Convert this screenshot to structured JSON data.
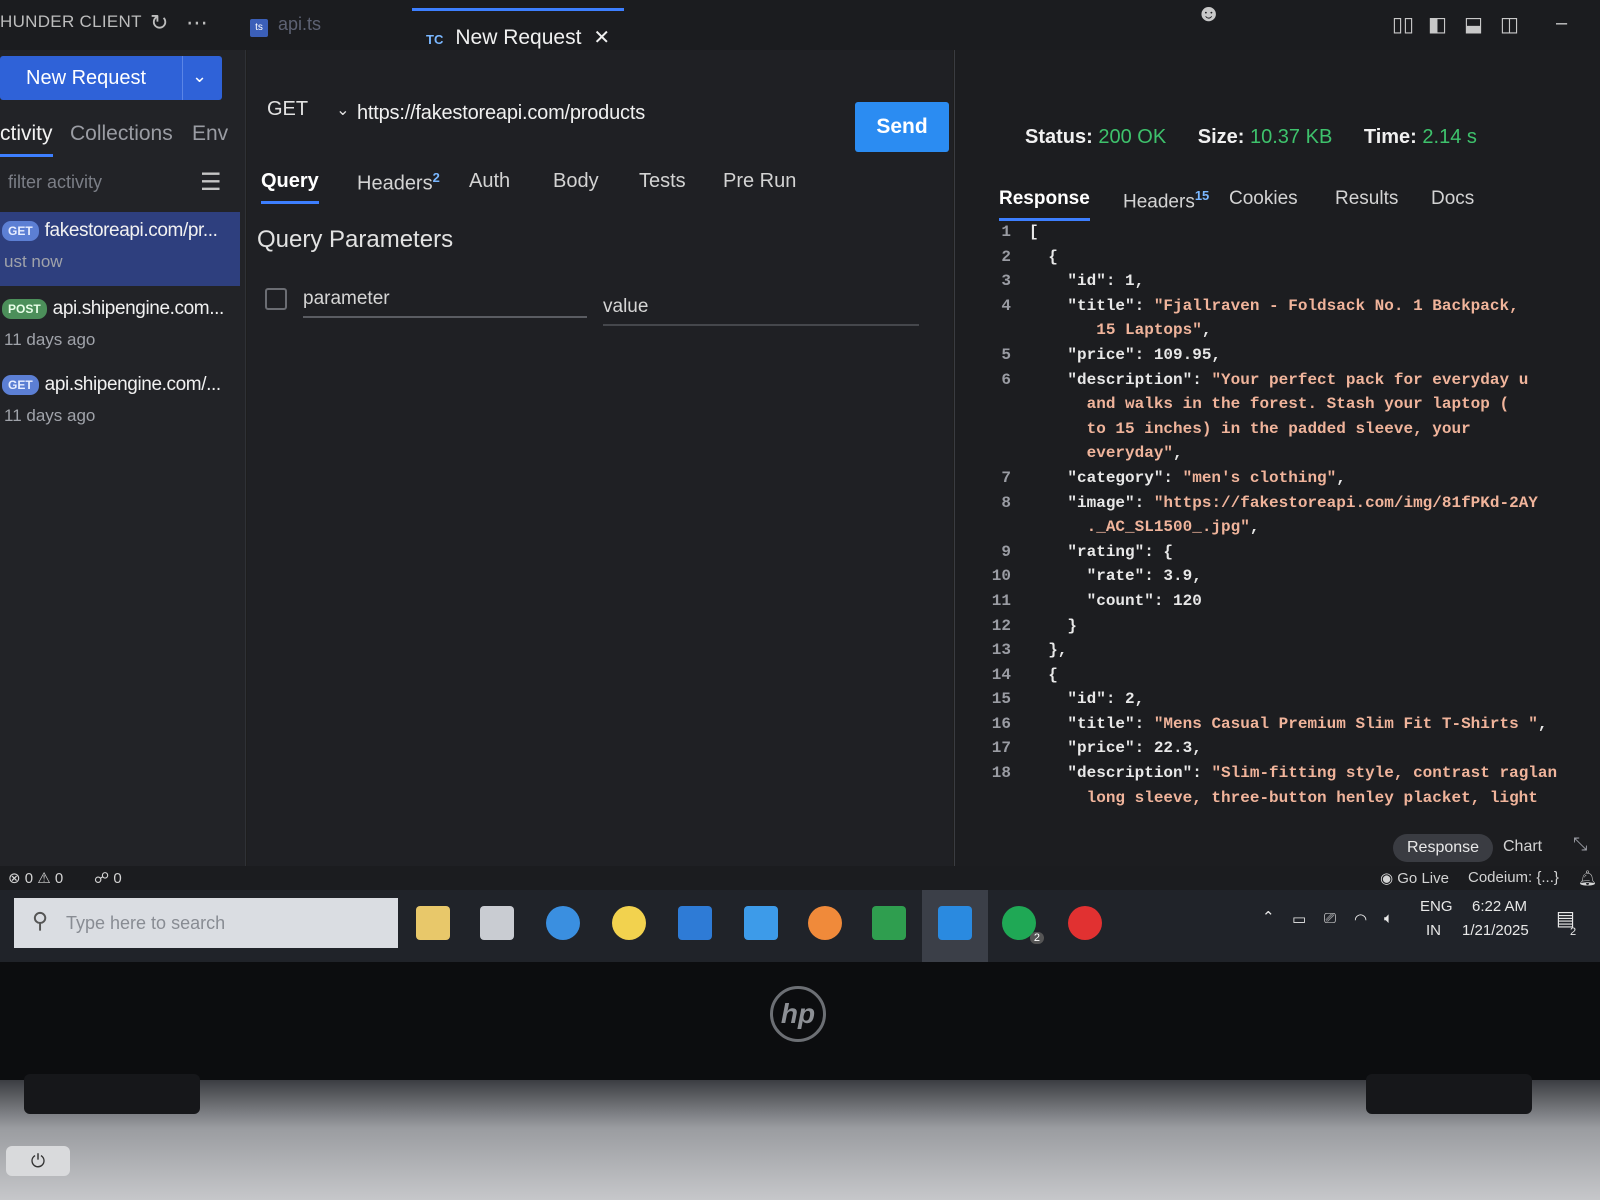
{
  "app": {
    "title": "HUNDER CLIENT",
    "file_tab": "api.ts",
    "file_tab_badge": "ts",
    "active_tab_icon": "TC",
    "active_tab": "New Request"
  },
  "sidebar": {
    "new_request_label": "New Request",
    "tabs": [
      "ctivity",
      "Collections",
      "Env"
    ],
    "filter_placeholder": "filter activity",
    "items": [
      {
        "method": "GET",
        "url": "fakestoreapi.com/pr...",
        "time": "ust now"
      },
      {
        "method": "POST",
        "url": "api.shipengine.com...",
        "time": "11 days ago"
      },
      {
        "method": "GET",
        "url": "api.shipengine.com/...",
        "time": "11 days ago"
      }
    ]
  },
  "request": {
    "method": "GET",
    "url": "https://fakestoreapi.com/products",
    "send_label": "Send",
    "tabs": [
      "Query",
      "Headers",
      "Auth",
      "Body",
      "Tests",
      "Pre Run"
    ],
    "headers_count": "2",
    "section_title": "Query Parameters",
    "param_placeholder": "parameter",
    "value_placeholder": "value"
  },
  "response": {
    "status_label": "Status:",
    "status_value": "200 OK",
    "size_label": "Size:",
    "size_value": "10.37 KB",
    "time_label": "Time:",
    "time_value": "2.14 s",
    "tabs": [
      "Response",
      "Headers",
      "Cookies",
      "Results",
      "Docs"
    ],
    "headers_count": "15",
    "footer_response": "Response",
    "footer_chart": "Chart",
    "lines": [
      {
        "n": "1",
        "pre": "[",
        "str": "",
        "post": ""
      },
      {
        "n": "2",
        "pre": "  {",
        "str": "",
        "post": ""
      },
      {
        "n": "3",
        "pre": "    \"id\": 1,",
        "str": "",
        "post": ""
      },
      {
        "n": "4",
        "pre": "    \"title\": ",
        "str": "\"Fjallraven - Foldsack No. 1 Backpack,",
        "post": ""
      },
      {
        "n": "",
        "pre": "",
        "str": "       15 Laptops\"",
        "post": ","
      },
      {
        "n": "5",
        "pre": "    \"price\": 109.95,",
        "str": "",
        "post": ""
      },
      {
        "n": "6",
        "pre": "    \"description\": ",
        "str": "\"Your perfect pack for everyday u",
        "post": ""
      },
      {
        "n": "",
        "pre": "",
        "str": "      and walks in the forest. Stash your laptop (",
        "post": ""
      },
      {
        "n": "",
        "pre": "",
        "str": "      to 15 inches) in the padded sleeve, your",
        "post": ""
      },
      {
        "n": "",
        "pre": "",
        "str": "      everyday\"",
        "post": ","
      },
      {
        "n": "7",
        "pre": "    \"category\": ",
        "str": "\"men's clothing\"",
        "post": ","
      },
      {
        "n": "8",
        "pre": "    \"image\": ",
        "str": "\"https://fakestoreapi.com/img/81fPKd-2AY",
        "post": ""
      },
      {
        "n": "",
        "pre": "",
        "str": "      ._AC_SL1500_.jpg\"",
        "post": ","
      },
      {
        "n": "9",
        "pre": "    \"rating\": {",
        "str": "",
        "post": ""
      },
      {
        "n": "10",
        "pre": "      \"rate\": 3.9,",
        "str": "",
        "post": ""
      },
      {
        "n": "11",
        "pre": "      \"count\": 120",
        "str": "",
        "post": ""
      },
      {
        "n": "12",
        "pre": "    }",
        "str": "",
        "post": ""
      },
      {
        "n": "13",
        "pre": "  },",
        "str": "",
        "post": ""
      },
      {
        "n": "14",
        "pre": "  {",
        "str": "",
        "post": ""
      },
      {
        "n": "15",
        "pre": "    \"id\": 2,",
        "str": "",
        "post": ""
      },
      {
        "n": "16",
        "pre": "    \"title\": ",
        "str": "\"Mens Casual Premium Slim Fit T-Shirts \"",
        "post": ","
      },
      {
        "n": "17",
        "pre": "    \"price\": 22.3,",
        "str": "",
        "post": ""
      },
      {
        "n": "18",
        "pre": "    \"description\": ",
        "str": "\"Slim-fitting style, contrast raglan",
        "post": ""
      },
      {
        "n": "",
        "pre": "",
        "str": "      long sleeve, three-button henley placket, light",
        "post": ""
      }
    ]
  },
  "statusbar": {
    "errors": "0",
    "warnings": "0",
    "ports": "0",
    "go_live": "Go Live",
    "codeium": "Codeium: {...}"
  },
  "taskbar": {
    "search_placeholder": "Type here to search",
    "lang_top": "ENG",
    "lang_bottom": "IN",
    "time": "6:22 AM",
    "date": "1/21/2025",
    "notif_count": "2",
    "whatsapp_count": "2"
  },
  "laptop": {
    "logo": "hp"
  },
  "colors": {
    "accent": "#3d7fff",
    "send": "#2b8cf2",
    "status_ok": "#3ec26c",
    "string": "#f0b49b"
  }
}
